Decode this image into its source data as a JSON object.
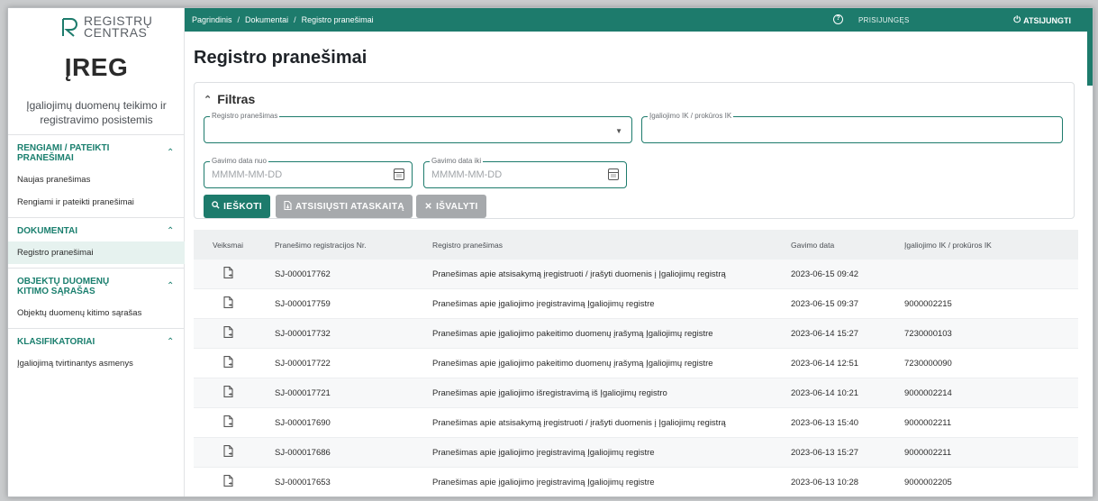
{
  "logo": {
    "line1": "REGISTRŲ",
    "line2": "CENTRAS"
  },
  "app": {
    "title": "ĮREG",
    "subtitle": "Įgaliojimų duomenų teikimo ir registravimo posistemis"
  },
  "sidebar": {
    "sections": [
      {
        "label": "RENGIAMI / PATEIKTI PRANEŠIMAI",
        "items": [
          "Naujas pranešimas",
          "Rengiami ir pateikti pranešimai"
        ]
      },
      {
        "label": "DOKUMENTAI",
        "items": [
          "Registro pranešimai"
        ]
      },
      {
        "label": "OBJEKTŲ DUOMENŲ KITIMO SĄRAŠAS",
        "items": [
          "Objektų duomenų kitimo sąrašas"
        ]
      },
      {
        "label": "KLASIFIKATORIAI",
        "items": [
          "Įgaliojimą tvirtinantys asmenys"
        ]
      }
    ],
    "active_item": "Registro pranešimai"
  },
  "topbar": {
    "breadcrumb": [
      "Pagrindinis",
      "Dokumentai",
      "Registro pranešimai"
    ],
    "separator": "/",
    "help_icon": "?",
    "login": "PRISIJUNGĘS",
    "logout": "ATSIJUNGTI"
  },
  "page": {
    "title": "Registro pranešimai"
  },
  "filter": {
    "title": "Filtras",
    "registry_notice_label": "Registro pranešimas",
    "power_ik_label": "Įgaliojimo IK / prokūros IK",
    "date_from_label": "Gavimo data nuo",
    "date_from_placeholder": "MMMM-MM-DD",
    "date_to_label": "Gavimo data iki",
    "date_to_placeholder": "MMMM-MM-DD",
    "search_button": "IEŠKOTI",
    "download_button": "ATSISIŲSTI ATASKAITĄ",
    "clear_button": "IŠVALYTI"
  },
  "table": {
    "headers": [
      "Veiksmai",
      "Pranešimo registracijos Nr.",
      "Registro pranešimas",
      "Gavimo data",
      "Įgaliojimo IK / prokūros IK"
    ],
    "rows": [
      [
        "SJ-000017762",
        "Pranešimas apie atsisakymą įregistruoti / įrašyti duomenis į Įgaliojimų registrą",
        "2023-06-15 09:42",
        ""
      ],
      [
        "SJ-000017759",
        "Pranešimas apie įgaliojimo įregistravimą Įgaliojimų registre",
        "2023-06-15 09:37",
        "9000002215"
      ],
      [
        "SJ-000017732",
        "Pranešimas apie įgaliojimo pakeitimo duomenų įrašymą Įgaliojimų registre",
        "2023-06-14 15:27",
        "7230000103"
      ],
      [
        "SJ-000017722",
        "Pranešimas apie įgaliojimo pakeitimo duomenų įrašymą Įgaliojimų registre",
        "2023-06-14 12:51",
        "7230000090"
      ],
      [
        "SJ-000017721",
        "Pranešimas apie įgaliojimo išregistravimą iš Įgaliojimų registro",
        "2023-06-14 10:21",
        "9000002214"
      ],
      [
        "SJ-000017690",
        "Pranešimas apie atsisakymą įregistruoti / įrašyti duomenis į Įgaliojimų registrą",
        "2023-06-13 15:40",
        "9000002211"
      ],
      [
        "SJ-000017686",
        "Pranešimas apie įgaliojimo įregistravimą Įgaliojimų registre",
        "2023-06-13 15:27",
        "9000002211"
      ],
      [
        "SJ-000017653",
        "Pranešimas apie įgaliojimo įregistravimą Įgaliojimų registre",
        "2023-06-13 10:28",
        "9000002205"
      ]
    ]
  },
  "colors": {
    "accent": "#1d7b6c",
    "active_bg": "#e6f2ef",
    "grey_button": "#a6a9ac"
  }
}
